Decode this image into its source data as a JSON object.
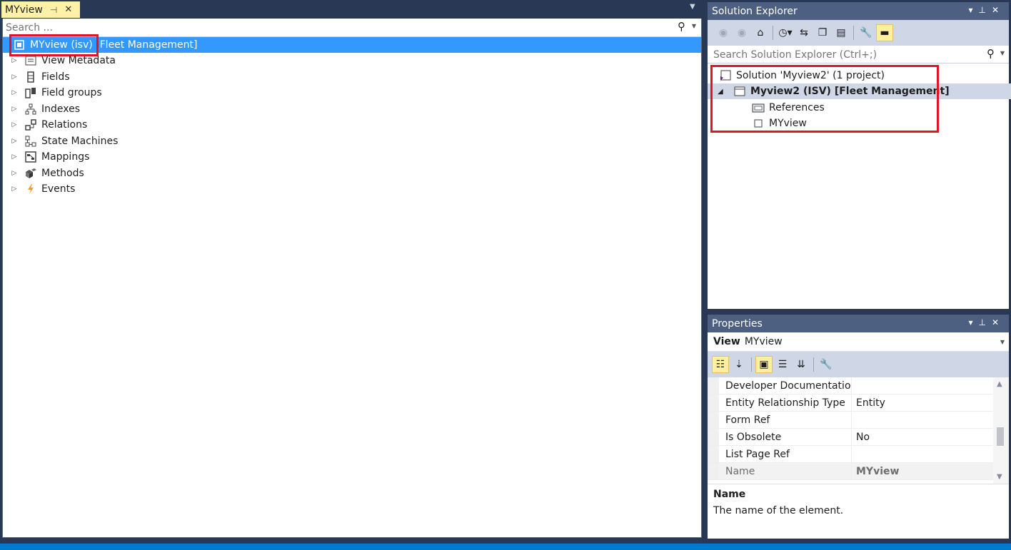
{
  "editor": {
    "tab_label": "MYview",
    "search_placeholder": "Search ...",
    "root": {
      "label": "MYview (isv) [Fleet Management]"
    },
    "nodes": [
      {
        "label": "View Metadata"
      },
      {
        "label": "Fields"
      },
      {
        "label": "Field groups"
      },
      {
        "label": "Indexes"
      },
      {
        "label": "Relations"
      },
      {
        "label": "State Machines"
      },
      {
        "label": "Mappings"
      },
      {
        "label": "Methods"
      },
      {
        "label": "Events"
      }
    ]
  },
  "solution_explorer": {
    "title": "Solution Explorer",
    "search_placeholder": "Search Solution Explorer (Ctrl+;)",
    "items": [
      {
        "label": "Solution 'Myview2' (1 project)"
      },
      {
        "label": "Myview2 (ISV) [Fleet Management]"
      },
      {
        "label": "References"
      },
      {
        "label": "MYview"
      }
    ]
  },
  "properties": {
    "title": "Properties",
    "object_kind": "View",
    "object_name": "MYview",
    "rows": [
      {
        "name": "Developer Documentation",
        "value": ""
      },
      {
        "name": "Entity Relationship Type",
        "value": "Entity"
      },
      {
        "name": "Form Ref",
        "value": ""
      },
      {
        "name": "Is Obsolete",
        "value": "No"
      },
      {
        "name": "List Page Ref",
        "value": ""
      },
      {
        "name": "Name",
        "value": "MYview"
      }
    ],
    "description_title": "Name",
    "description_text": "The name of the element."
  },
  "colors": {
    "window_bg": "#293955",
    "panel_title": "#4d6082",
    "selection": "#3399ff",
    "active_tab": "#fff1a8",
    "highlight_box": "#e81123",
    "status_bar": "#007acc"
  },
  "icons": {
    "view-icon": "square",
    "metadata-icon": "document",
    "fields-icon": "column",
    "field-groups-icon": "grid",
    "indexes-icon": "hierarchy",
    "relations-icon": "link",
    "state-machines-icon": "flow",
    "mappings-icon": "map",
    "methods-icon": "cubes",
    "events-icon": "lightning"
  }
}
